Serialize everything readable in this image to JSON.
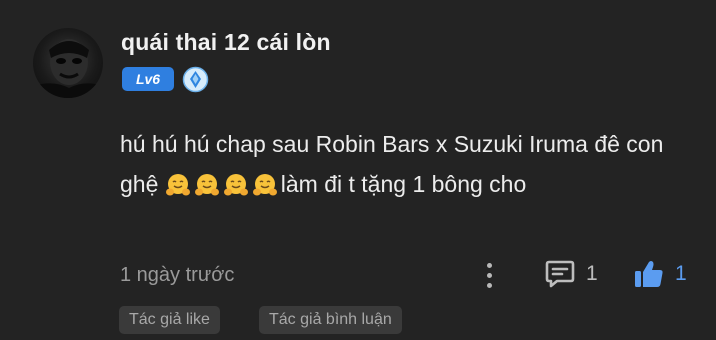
{
  "comment": {
    "username": "quái thai 12 cái lòn",
    "level_badge": "Lv6",
    "text_part1": "hú hú hú chap sau Robin Bars x Suzuki Iruma đê con ghệ ",
    "emojis": [
      "hugging-face-emoji",
      "hugging-face-emoji",
      "hugging-face-emoji",
      "hugging-face-emoji"
    ],
    "text_part2": "làm đi t tặng 1 bông cho",
    "timestamp": "1 ngày trước",
    "reply_count": "1",
    "like_count": "1"
  },
  "tags": {
    "author_like": "Tác giả like",
    "author_comment": "Tác giả bình luận"
  },
  "icons": {
    "more": "more-vertical-icon",
    "reply": "comment-icon",
    "like": "thumbs-up-icon",
    "rank": "diamond-rank-icon"
  },
  "colors": {
    "background": "#232323",
    "accent": "#2f7fe0",
    "like": "#5b9cf0",
    "muted": "#9a9a9a"
  }
}
